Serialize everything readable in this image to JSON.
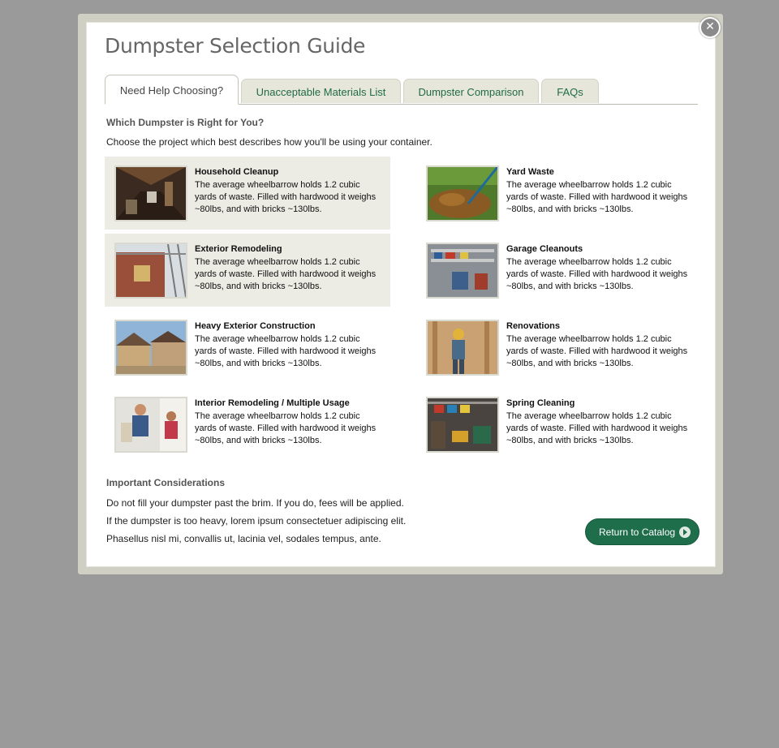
{
  "window": {
    "close_icon": "close-icon",
    "title": "Dumpster Selection Guide"
  },
  "tabs": [
    {
      "label": "Need Help Choosing?",
      "active": true
    },
    {
      "label": "Unacceptable Materials List",
      "active": false
    },
    {
      "label": "Dumpster Comparison",
      "active": false
    },
    {
      "label": "FAQs",
      "active": false
    }
  ],
  "intro": {
    "heading": "Which Dumpster is Right for You?",
    "text": "Choose the project which best describes how you'll be using your container."
  },
  "projects": [
    {
      "title": "Household Cleanup",
      "desc": "The average wheelbarrow holds 1.2 cubic yards of waste. Filled with hardwood it weighs ~80lbs, and with bricks ~130lbs.",
      "highlighted": true
    },
    {
      "title": "Yard Waste",
      "desc": "The average wheelbarrow holds 1.2 cubic yards of waste. Filled with hardwood it weighs ~80lbs, and with bricks ~130lbs.",
      "highlighted": false
    },
    {
      "title": "Exterior Remodeling",
      "desc": "The average wheelbarrow holds 1.2 cubic yards of waste. Filled with hardwood it weighs ~80lbs, and with bricks ~130lbs.",
      "highlighted": true
    },
    {
      "title": "Garage Cleanouts",
      "desc": "The average wheelbarrow holds 1.2 cubic yards of waste. Filled with hardwood it weighs ~80lbs, and with bricks ~130lbs.",
      "highlighted": false
    },
    {
      "title": "Heavy Exterior Construction",
      "desc": "The average wheelbarrow holds 1.2 cubic yards of waste. Filled with hardwood it weighs ~80lbs, and with bricks ~130lbs.",
      "highlighted": false
    },
    {
      "title": "Renovations",
      "desc": "The average wheelbarrow holds 1.2 cubic yards of waste. Filled with hardwood it weighs ~80lbs, and with bricks ~130lbs.",
      "highlighted": false
    },
    {
      "title": "Interior Remodeling / Multiple Usage",
      "desc": "The average wheelbarrow holds 1.2 cubic yards of waste. Filled with hardwood it weighs ~80lbs, and with bricks ~130lbs.",
      "highlighted": false
    },
    {
      "title": "Spring Cleaning",
      "desc": "The average wheelbarrow holds 1.2 cubic yards of waste. Filled with hardwood it weighs ~80lbs, and with bricks ~130lbs.",
      "highlighted": false
    }
  ],
  "considerations": {
    "heading": "Important Considerations",
    "lines": [
      "Do not fill your dumpster past the brim. If you do, fees will be applied.",
      "If the dumpster is too heavy, lorem ipsum consectetuer adipiscing elit.",
      "Phasellus nisl mi, convallis ut, lacinia vel, sodales tempus, ante."
    ]
  },
  "footer": {
    "return_button": "Return to Catalog"
  },
  "colors": {
    "accent_green": "#1e6e4b",
    "tab_bg": "#e7e6db",
    "highlight_bg": "#ecebe4",
    "overlay": "#9a9a9a"
  }
}
